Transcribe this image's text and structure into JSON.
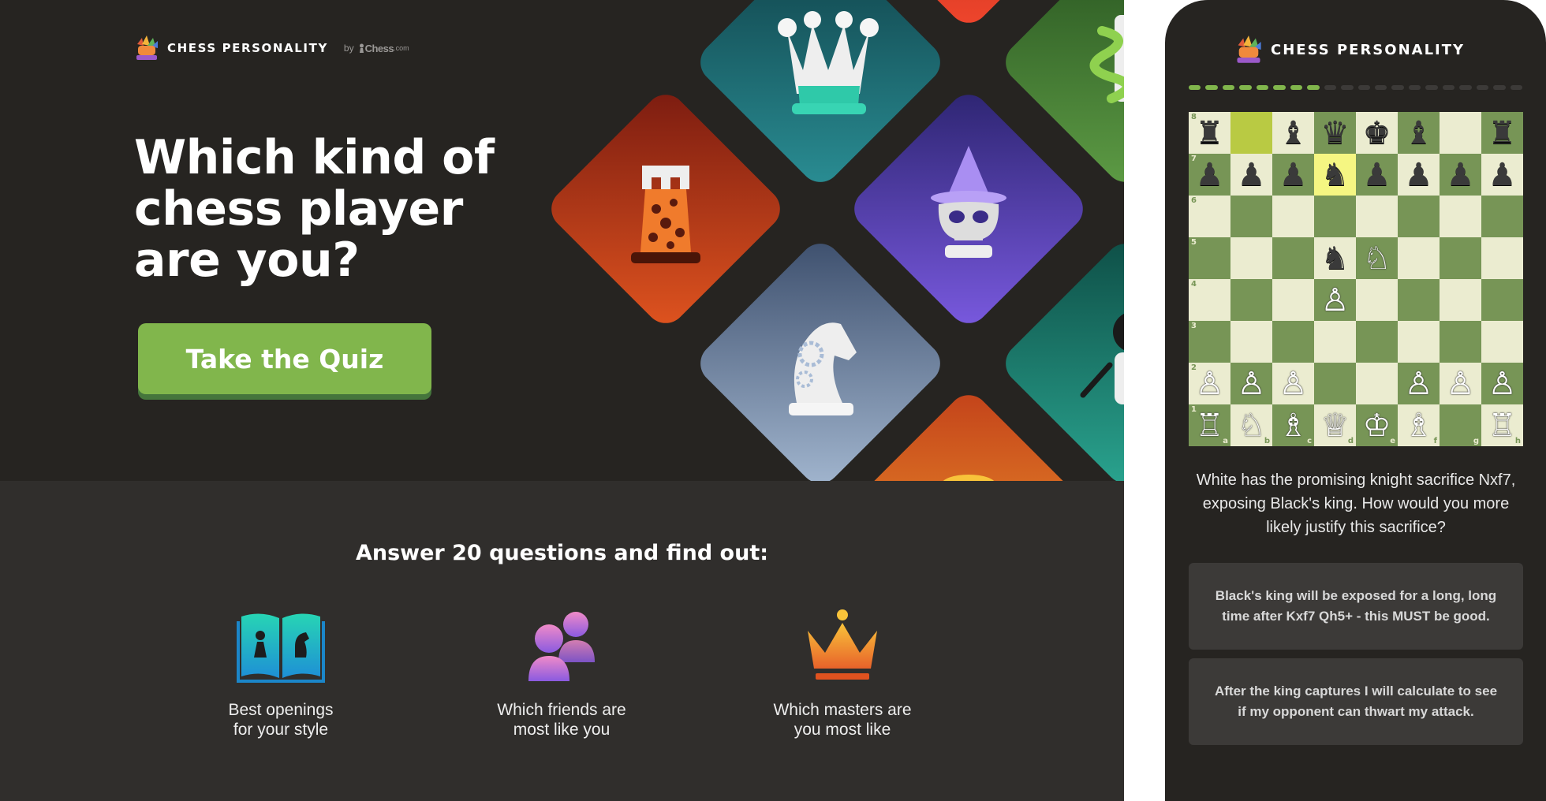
{
  "landing": {
    "brand": {
      "name": "CHESS PERSONALITY",
      "by": "by",
      "partner": "Chess",
      "partner_suffix": ".com"
    },
    "hero": {
      "title": "Which kind of chess player are you?",
      "cta_label": "Take the Quiz"
    },
    "tiles": [
      {
        "icon": "crown-queen-icon",
        "color": "#1d6c75"
      },
      {
        "icon": "leopard-rook-icon",
        "color": "#c2401b"
      },
      {
        "icon": "wizard-bishop-icon",
        "color": "#5b46b8"
      },
      {
        "icon": "mechanical-knight-icon",
        "color": "#6f87a8"
      },
      {
        "icon": "serpent-piece-icon",
        "color": "#3c7a32"
      },
      {
        "icon": "painter-pawn-icon",
        "color": "#1e7f70"
      },
      {
        "icon": "red-piece-icon",
        "color": "#e2412b"
      },
      {
        "icon": "orange-piece-icon",
        "color": "#e8762a"
      }
    ],
    "features_title": "Answer 20 questions and find out:",
    "features": [
      {
        "icon": "opening-book-icon",
        "label": "Best openings\nfor your style"
      },
      {
        "icon": "friends-icon",
        "label": "Which friends are\nmost like you"
      },
      {
        "icon": "master-crown-icon",
        "label": "Which masters are\nyou most like"
      }
    ]
  },
  "quiz": {
    "brand": {
      "name": "CHESS PERSONALITY"
    },
    "progress": {
      "completed": 8,
      "total": 20
    },
    "board": {
      "ranks": [
        "8",
        "7",
        "6",
        "5",
        "4",
        "3",
        "2",
        "1"
      ],
      "files": [
        "a",
        "b",
        "c",
        "d",
        "e",
        "f",
        "g",
        "h"
      ],
      "position": [
        [
          "♜",
          "",
          "♝",
          "♛",
          "♚",
          "♝",
          "",
          "♜"
        ],
        [
          "♟",
          "♟",
          "♟",
          "♞",
          "♟",
          "♟",
          "♟",
          "♟"
        ],
        [
          "",
          "",
          "",
          "",
          "",
          "",
          "",
          ""
        ],
        [
          "",
          "",
          "",
          "♞",
          "♘",
          "",
          "",
          ""
        ],
        [
          "",
          "",
          "",
          "♙",
          "",
          "",
          "",
          ""
        ],
        [
          "",
          "",
          "",
          "",
          "",
          "",
          "",
          ""
        ],
        [
          "♙",
          "♙",
          "♙",
          "",
          "",
          "♙",
          "♙",
          "♙"
        ],
        [
          "♖",
          "♘",
          "♗",
          "♕",
          "♔",
          "♗",
          "",
          "♖"
        ]
      ],
      "highlights": [
        "b8",
        "d7"
      ]
    },
    "question": "White has the promising knight sacrifice Nxf7, exposing Black's king. How would you more likely justify this sacrifice?",
    "answers": [
      "Black's king will be exposed for a long, long time after Kxf7 Qh5+ - this MUST be good.",
      "After the king captures I will calculate to see if my opponent can thwart my attack."
    ]
  },
  "colors": {
    "accent_green": "#81b64c",
    "hero_bg": "#262421",
    "section_bg": "#302e2c",
    "board_light": "#ebecd0",
    "board_dark": "#779556"
  }
}
